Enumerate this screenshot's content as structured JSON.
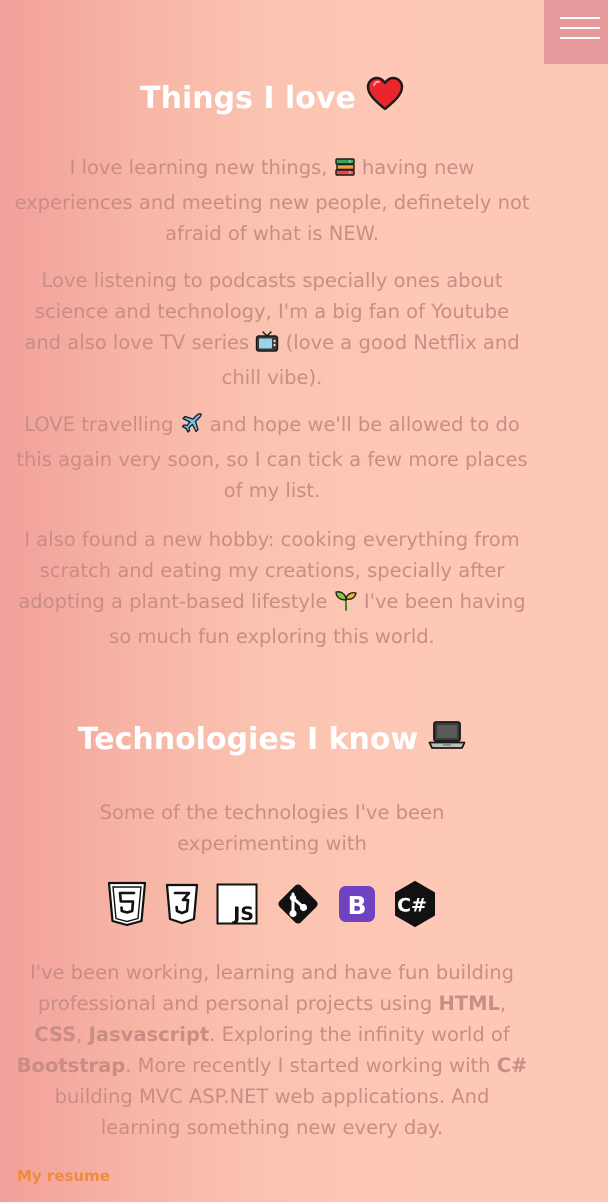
{
  "nav": {
    "menu_icon": "hamburger-menu-icon"
  },
  "love": {
    "title": "Things I love",
    "title_icon": "heart-icon",
    "p1": {
      "before": "I love learning new things,",
      "emoji": "books-icon",
      "after": "having new experiences and meeting new people, definetely not afraid of what is NEW."
    },
    "p2": {
      "before": "Love listening to podcasts specially ones about science and technology, I'm a big fan of Youtube and also love TV series",
      "emoji": "tv-icon",
      "after": "(love a good Netflix and chill vibe)."
    },
    "p3": {
      "before": "LOVE travelling",
      "emoji": "airplane-icon",
      "after": "and hope we'll be allowed to do this again very soon, so I can tick a few more places of my list."
    },
    "p4": {
      "before": "I also found a new hobby: cooking everything from scratch and eating my creations, specially after adopting a plant-based lifestyle",
      "emoji": "seedling-icon",
      "after": "I've been having so much fun exploring this world."
    }
  },
  "tech": {
    "title": "Technologies I know",
    "title_icon": "laptop-icon",
    "intro": "Some of the technologies I've been experimenting with",
    "icons": [
      "html5-icon",
      "css3-icon",
      "javascript-icon",
      "git-icon",
      "bootstrap-icon",
      "csharp-icon"
    ],
    "icon_text": {
      "js": "JS",
      "bootstrap": "B",
      "csharp": "C#"
    },
    "body": {
      "t1": "I've been working, learning and have fun building professional and personal projects using",
      "html": "HTML",
      "c1": ",",
      "css": "CSS",
      "c2": ",",
      "js": "Jasvascript",
      "t2": ". Exploring the infinity world of",
      "bootstrap": "Bootstrap",
      "t3": ". More recently I started working with",
      "csharp": "C#",
      "t4": "building MVC ASP.NET web applications. And learning something new every day."
    }
  },
  "footer": {
    "resume_link": "My resume"
  }
}
